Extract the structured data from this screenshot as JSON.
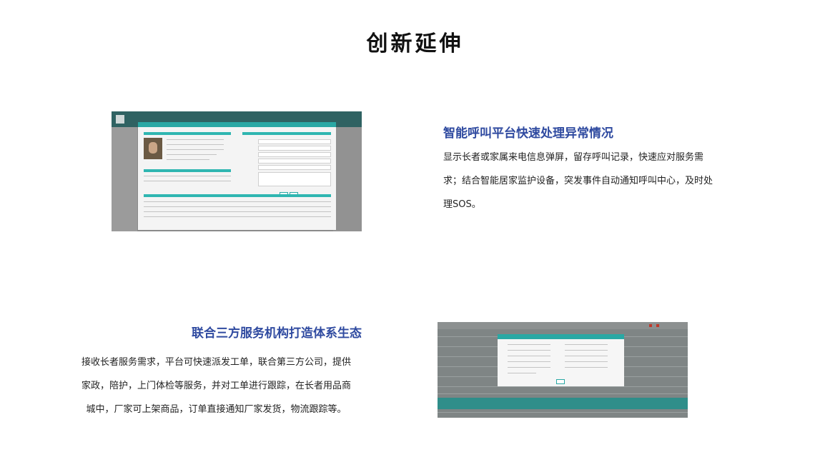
{
  "page": {
    "title": "创新延伸"
  },
  "features": [
    {
      "title": "智能呼叫平台快速处理异常情况",
      "desc_lines": [
        "显示长者或家属来电信息弹屏，留存呼叫记录，快速应对服务需",
        "求；结合智能居家监护设备，突发事件自动通知呼叫中心，及时处",
        "理SOS。"
      ]
    },
    {
      "title": "联合三方服务机构打造体系生态",
      "desc_lines": [
        "接收长者服务需求，平台可快速派发工单，联合第三方公司，提供",
        "家政，陪护，上门体检等服务，并对工单进行跟踪，在长者用品商",
        "城中，厂家可上架商品，订单直接通知厂家发货，物流跟踪等。"
      ]
    }
  ],
  "screenshots": {
    "call_platform": {
      "icon": "call-center-screenshot"
    },
    "order_platform": {
      "icon": "work-order-screenshot"
    }
  },
  "colors": {
    "accent_title": "#2f4aa0",
    "teal": "#2aa8a4"
  }
}
